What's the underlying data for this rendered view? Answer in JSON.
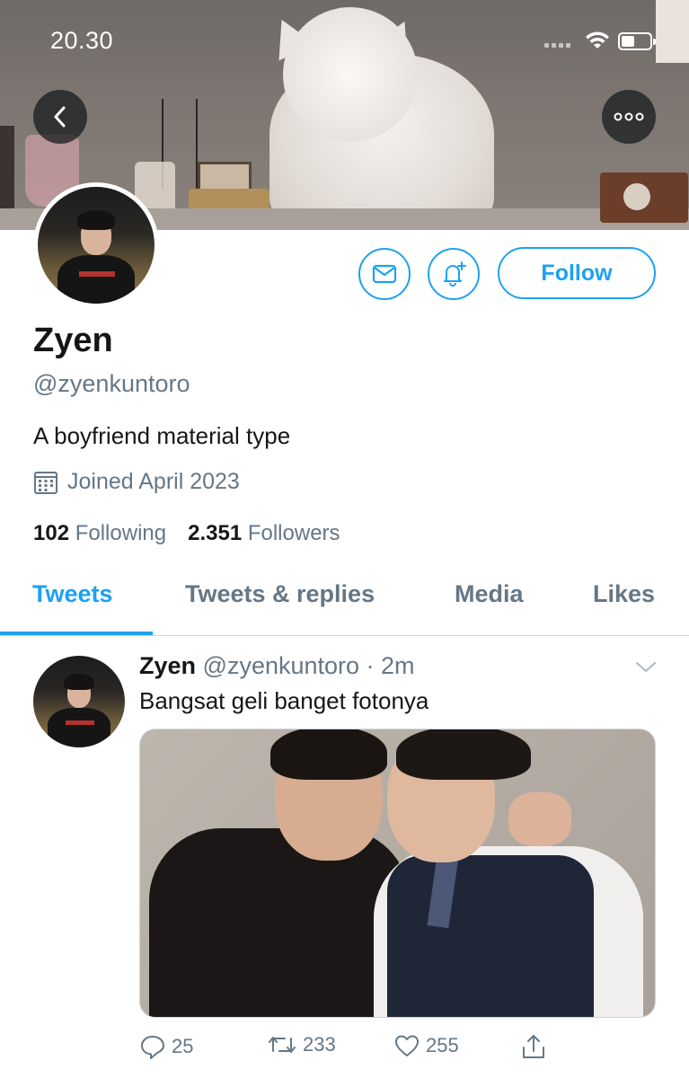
{
  "status_bar": {
    "time": "20.30"
  },
  "banner": {
    "description_icon": "banner-photo"
  },
  "profile": {
    "name": "Zyen",
    "handle": "@zyenkuntoro",
    "bio": "A boyfriend material type",
    "joined": "Joined April 2023",
    "following_count": "102",
    "following_label": "Following",
    "followers_count": "2.351",
    "followers_label": "Followers"
  },
  "actions": {
    "follow_label": "Follow"
  },
  "tabs": [
    {
      "label": "Tweets",
      "active": true
    },
    {
      "label": "Tweets & replies",
      "active": false
    },
    {
      "label": "Media",
      "active": false
    },
    {
      "label": "Likes",
      "active": false
    }
  ],
  "tweet": {
    "name": "Zyen",
    "meta": "@zyenkuntoro · 2m",
    "text": "Bangsat geli banget fotonya",
    "replies": "25",
    "retweets": "233",
    "likes": "255"
  },
  "colors": {
    "accent": "#1da1f2",
    "secondary_text": "#657786",
    "primary_text": "#14171a"
  }
}
